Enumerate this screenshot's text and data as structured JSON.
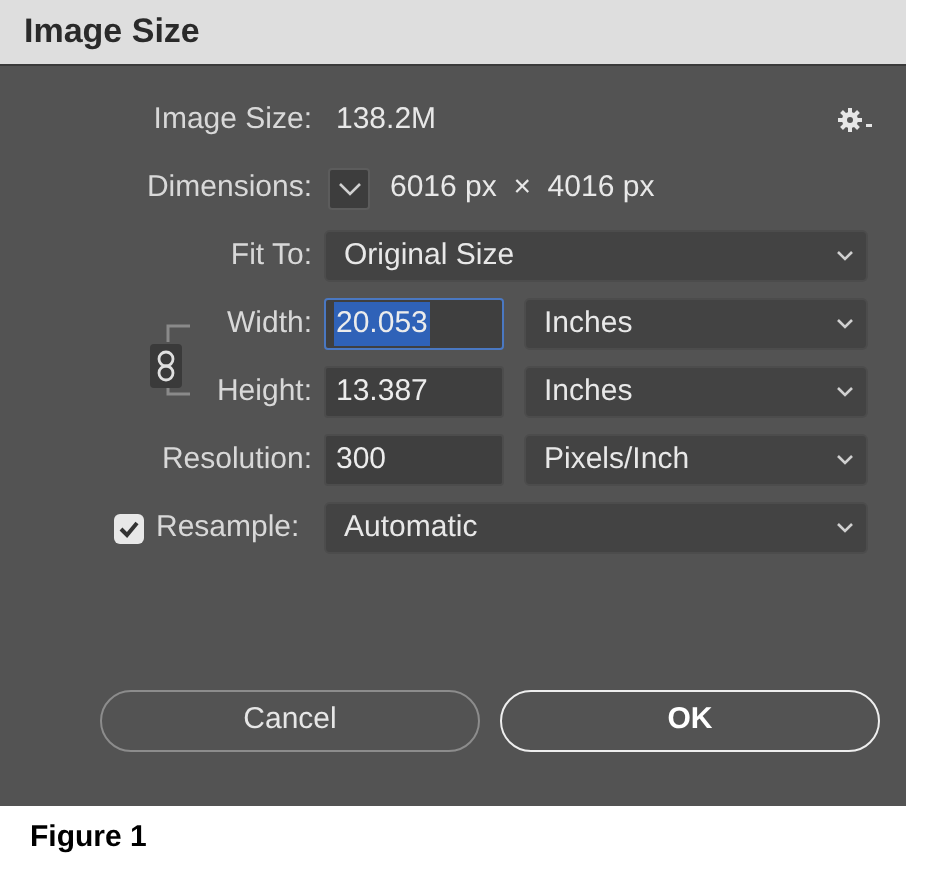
{
  "window": {
    "title": "Image Size"
  },
  "image_size": {
    "label": "Image Size:",
    "value": "138.2M"
  },
  "dimensions": {
    "label": "Dimensions:",
    "value": "6016 px  ×  4016 px"
  },
  "fit_to": {
    "label": "Fit To:",
    "value": "Original Size"
  },
  "size_fields": [
    {
      "label": "Width:",
      "value": "20.053",
      "text_selected": true,
      "unit": "Inches"
    },
    {
      "label": "Height:",
      "value": "13.387",
      "text_selected": false,
      "unit": "Inches"
    }
  ],
  "resolution": {
    "label": "Resolution:",
    "value": "300",
    "text_selected": false,
    "unit": "Pixels/Inch"
  },
  "resample": {
    "label": "Resample:",
    "checked": true,
    "value": "Automatic"
  },
  "buttons": [
    {
      "label": "Cancel",
      "default": false
    },
    {
      "label": "OK",
      "default": true
    }
  ],
  "caption": "Figure 1"
}
